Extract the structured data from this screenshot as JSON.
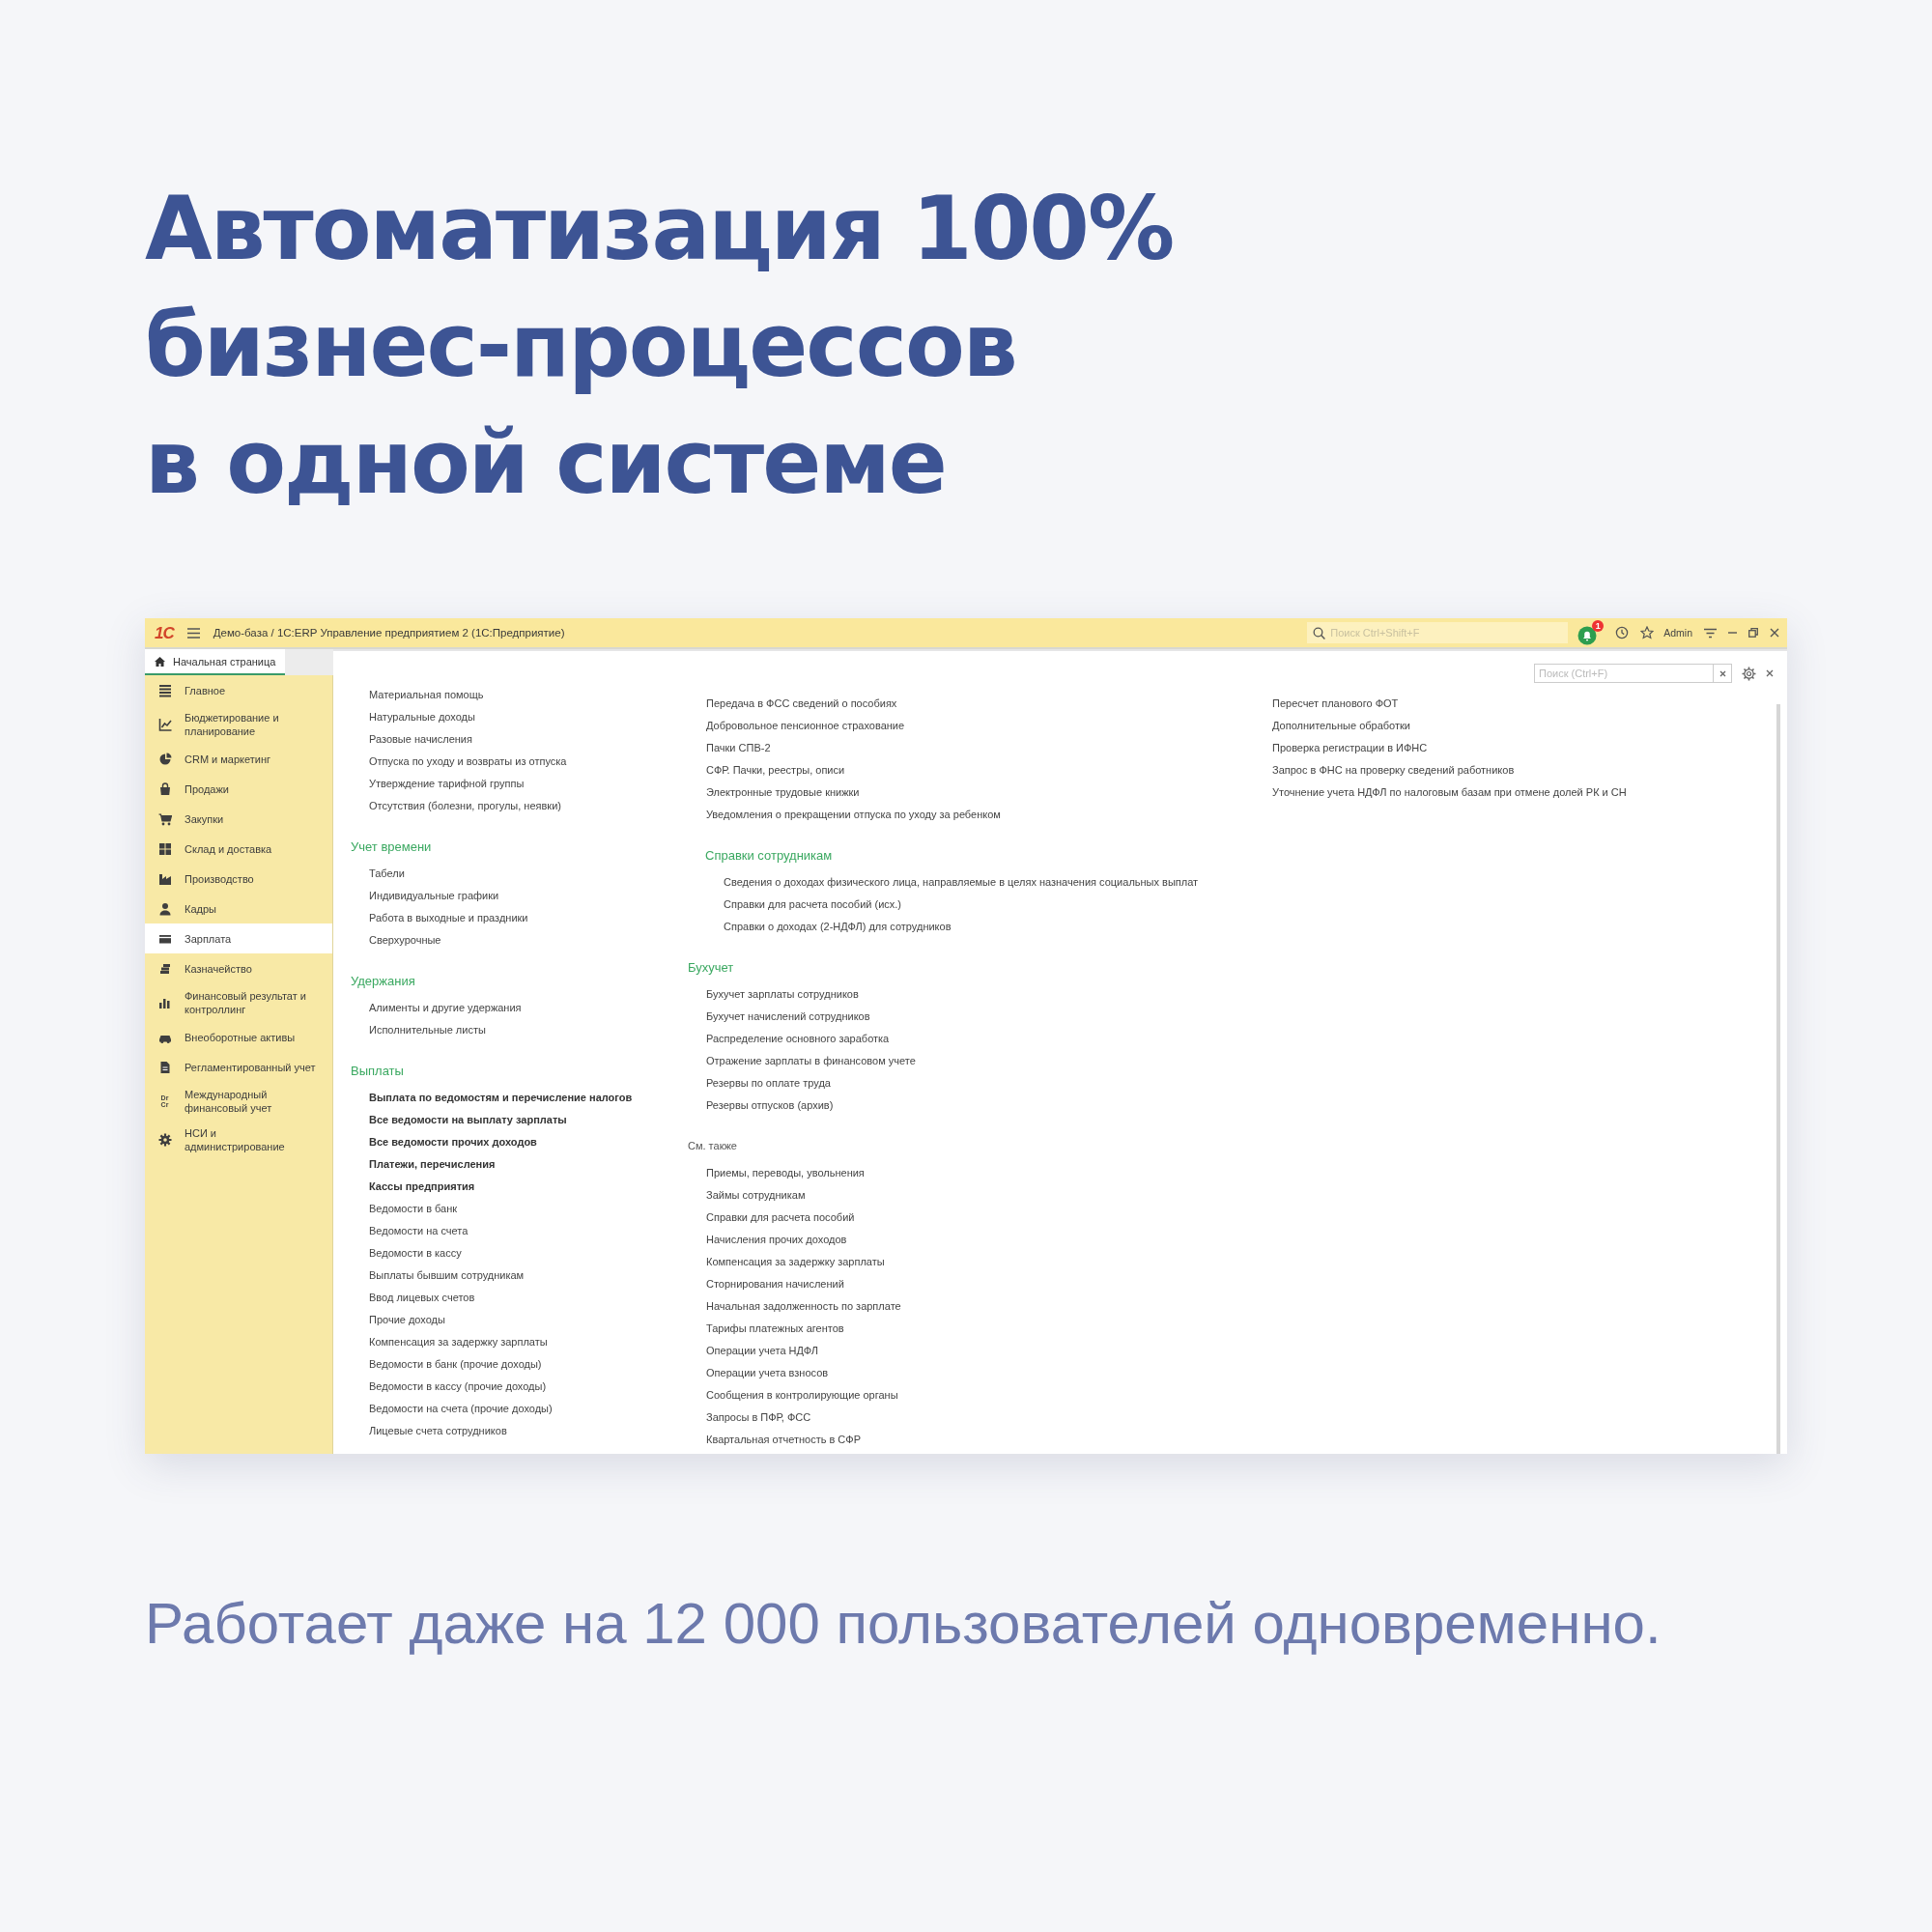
{
  "headline": "Автоматизация 100%\nбизнес-процессов\nв одной системе",
  "app": {
    "title_bar": {
      "logo": "1С",
      "title": "Демо-база / 1С:ERP Управление предприятием 2  (1С:Предприятие)",
      "search_placeholder": "Поиск Ctrl+Shift+F",
      "notifications": "1",
      "user": "Admin"
    },
    "tabs": [
      {
        "label": "Начальная страница",
        "selected": true
      }
    ],
    "sidebar": [
      {
        "label": "Главное",
        "selected": false
      },
      {
        "label": "Бюджетирование и\nпланирование",
        "selected": false
      },
      {
        "label": "CRM и маркетинг",
        "selected": false
      },
      {
        "label": "Продажи",
        "selected": false
      },
      {
        "label": "Закупки",
        "selected": false
      },
      {
        "label": "Склад и доставка",
        "selected": false
      },
      {
        "label": "Производство",
        "selected": false
      },
      {
        "label": "Кадры",
        "selected": false
      },
      {
        "label": "Зарплата",
        "selected": true
      },
      {
        "label": "Казначейство",
        "selected": false
      },
      {
        "label": "Финансовый результат и\nконтроллинг",
        "selected": false
      },
      {
        "label": "Внеоборотные активы",
        "selected": false
      },
      {
        "label": "Регламентированный учет",
        "selected": false
      },
      {
        "label": "Международный\nфинансовый учет",
        "selected": false,
        "icon_text": "Dr\nCr"
      },
      {
        "label": "НСИ и\nадминистрирование",
        "selected": false
      }
    ],
    "content": {
      "search_placeholder": "Поиск (Ctrl+F)",
      "columns": [
        {
          "groups": [
            {
              "items": [
                {
                  "text": "Материальная помощь",
                  "bold": false
                },
                {
                  "text": "Натуральные доходы",
                  "bold": false
                },
                {
                  "text": "Разовые начисления",
                  "bold": false
                },
                {
                  "text": "Отпуска по уходу и возвраты из отпуска",
                  "bold": false
                },
                {
                  "text": "Утверждение тарифной группы",
                  "bold": false
                },
                {
                  "text": "Отсутствия (болезни, прогулы, неявки)",
                  "bold": false
                }
              ]
            },
            {
              "heading": "Учет времени",
              "kind": "section",
              "items": [
                {
                  "text": "Табели",
                  "bold": false
                },
                {
                  "text": "Индивидуальные графики",
                  "bold": false
                },
                {
                  "text": "Работа в выходные и праздники",
                  "bold": false
                },
                {
                  "text": "Сверхурочные",
                  "bold": false
                }
              ]
            },
            {
              "heading": "Удержания",
              "kind": "section",
              "items": [
                {
                  "text": "Алименты и другие удержания",
                  "bold": false
                },
                {
                  "text": "Исполнительные листы",
                  "bold": false
                }
              ]
            },
            {
              "heading": "Выплаты",
              "kind": "section",
              "items": [
                {
                  "text": "Выплата по ведомостям и перечисление налогов",
                  "bold": true
                },
                {
                  "text": "Все ведомости на выплату зарплаты",
                  "bold": true
                },
                {
                  "text": "Все ведомости прочих доходов",
                  "bold": true
                },
                {
                  "text": "Платежи, перечисления",
                  "bold": true
                },
                {
                  "text": "Кассы предприятия",
                  "bold": true
                },
                {
                  "text": "Ведомости в банк",
                  "bold": false
                },
                {
                  "text": "Ведомости на счета",
                  "bold": false
                },
                {
                  "text": "Ведомости в кассу",
                  "bold": false
                },
                {
                  "text": "Выплаты бывшим сотрудникам",
                  "bold": false
                },
                {
                  "text": "Ввод лицевых счетов",
                  "bold": false
                },
                {
                  "text": "Прочие доходы",
                  "bold": false
                },
                {
                  "text": "Компенсация за задержку зарплаты",
                  "bold": false
                },
                {
                  "text": "Ведомости в банк (прочие доходы)",
                  "bold": false
                },
                {
                  "text": "Ведомости в кассу (прочие доходы)",
                  "bold": false
                },
                {
                  "text": "Ведомости на счета (прочие доходы)",
                  "bold": false
                },
                {
                  "text": "Лицевые счета сотрудников",
                  "bold": false
                }
              ]
            }
          ]
        },
        {
          "groups": [
            {
              "items": [
                {
                  "text": "Передача в ФСС сведений о пособиях",
                  "bold": false
                },
                {
                  "text": "Добровольное пенсионное страхование",
                  "bold": false
                },
                {
                  "text": "Пачки СПВ-2",
                  "bold": false
                },
                {
                  "text": "СФР. Пачки, реестры, описи",
                  "bold": false
                },
                {
                  "text": "Электронные трудовые книжки",
                  "bold": false
                },
                {
                  "text": "Уведомления о прекращении отпуска по уходу за ребенком",
                  "bold": false
                }
              ],
              "subgroups": [
                {
                  "heading": "Справки сотрудникам",
                  "kind": "section",
                  "items": [
                    {
                      "text": "Сведения о доходах физического лица, направляемые в целях назначения социальных выплат",
                      "bold": false
                    },
                    {
                      "text": "Справки для расчета пособий (исх.)",
                      "bold": false
                    },
                    {
                      "text": "Справки о доходах (2-НДФЛ) для сотрудников",
                      "bold": false
                    }
                  ]
                }
              ]
            },
            {
              "heading": "Бухучет",
              "kind": "section",
              "items": [
                {
                  "text": "Бухучет зарплаты сотрудников",
                  "bold": false
                },
                {
                  "text": "Бухучет начислений сотрудников",
                  "bold": false
                },
                {
                  "text": "Распределение основного заработка",
                  "bold": false
                },
                {
                  "text": "Отражение зарплаты в финансовом учете",
                  "bold": false
                },
                {
                  "text": "Резервы по оплате труда",
                  "bold": false
                },
                {
                  "text": "Резервы отпусков (архив)",
                  "bold": false
                }
              ]
            },
            {
              "heading": "См. также",
              "kind": "see_also",
              "items": [
                {
                  "text": "Приемы, переводы, увольнения",
                  "bold": false
                },
                {
                  "text": "Займы сотрудникам",
                  "bold": false
                },
                {
                  "text": "Справки для расчета пособий",
                  "bold": false
                },
                {
                  "text": "Начисления прочих доходов",
                  "bold": false
                },
                {
                  "text": "Компенсация за задержку зарплаты",
                  "bold": false
                },
                {
                  "text": "Сторнирования начислений",
                  "bold": false
                },
                {
                  "text": "Начальная задолженность по зарплате",
                  "bold": false
                },
                {
                  "text": "Тарифы платежных агентов",
                  "bold": false
                },
                {
                  "text": "Операции учета НДФЛ",
                  "bold": false
                },
                {
                  "text": "Операции учета взносов",
                  "bold": false
                },
                {
                  "text": "Сообщения в контролирующие органы",
                  "bold": false
                },
                {
                  "text": "Запросы в ПФР, ФСС",
                  "bold": false
                },
                {
                  "text": "Квартальная отчетность в СФР",
                  "bold": false
                }
              ]
            }
          ]
        },
        {
          "groups": [
            {
              "items": [
                {
                  "text": "Пересчет планового ФОТ",
                  "bold": false
                },
                {
                  "text": "Дополнительные обработки",
                  "bold": false
                },
                {
                  "text": "Проверка регистрации в ИФНС",
                  "bold": false
                },
                {
                  "text": "Запрос в ФНС на проверку сведений работников",
                  "bold": false
                },
                {
                  "text": "Уточнение учета НДФЛ по налоговым базам при отмене долей РК и СН",
                  "bold": false
                }
              ]
            }
          ]
        }
      ]
    }
  },
  "tagline": "Работает даже на 12 000 пользователей одновременно."
}
